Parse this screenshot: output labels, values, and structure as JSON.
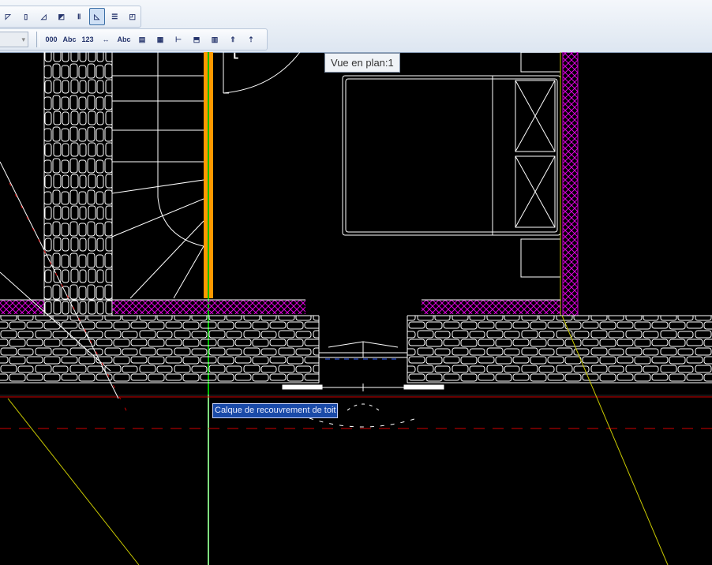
{
  "toolbar": {
    "row1": [
      {
        "name": "wall-tool-icon",
        "glyph": "◸"
      },
      {
        "name": "wall-straight-icon",
        "glyph": "▯"
      },
      {
        "name": "wall-curved-icon",
        "glyph": "◿"
      },
      {
        "name": "slab-icon",
        "glyph": "◩"
      },
      {
        "name": "column-icon",
        "glyph": "Ⅱ"
      },
      {
        "name": "roof-icon",
        "glyph": "◺",
        "active": true
      },
      {
        "name": "stairs-icon",
        "glyph": "☰"
      },
      {
        "name": "object-icon",
        "glyph": "◰"
      }
    ],
    "combo_value": "",
    "row2": [
      {
        "name": "dimension-icon",
        "label": "000"
      },
      {
        "name": "text-icon",
        "label": "Abc"
      },
      {
        "name": "number-icon",
        "label": "123"
      },
      {
        "name": "dimension-chain-icon",
        "label": "↔"
      },
      {
        "name": "label-text-icon",
        "label": "Abc"
      },
      {
        "name": "document-icon",
        "label": "▤"
      },
      {
        "name": "document-page-icon",
        "label": "▦"
      },
      {
        "name": "section-icon",
        "label": "⊢"
      },
      {
        "name": "elevation-icon",
        "label": "⬒"
      },
      {
        "name": "view-icon",
        "label": "▥"
      },
      {
        "name": "level-up-icon",
        "label": "⇑"
      },
      {
        "name": "level-arrow-icon",
        "label": "⇡"
      }
    ]
  },
  "view_tooltip": "Vue en plan:1",
  "layer_label": "Calque de recouvrement de toit",
  "colors": {
    "background": "#000000",
    "lines": "#ffffff",
    "insulation": "#d000d0",
    "green": "#00c000",
    "orange": "#ff9900",
    "yellow": "#c8c800",
    "red": "#d00000"
  }
}
